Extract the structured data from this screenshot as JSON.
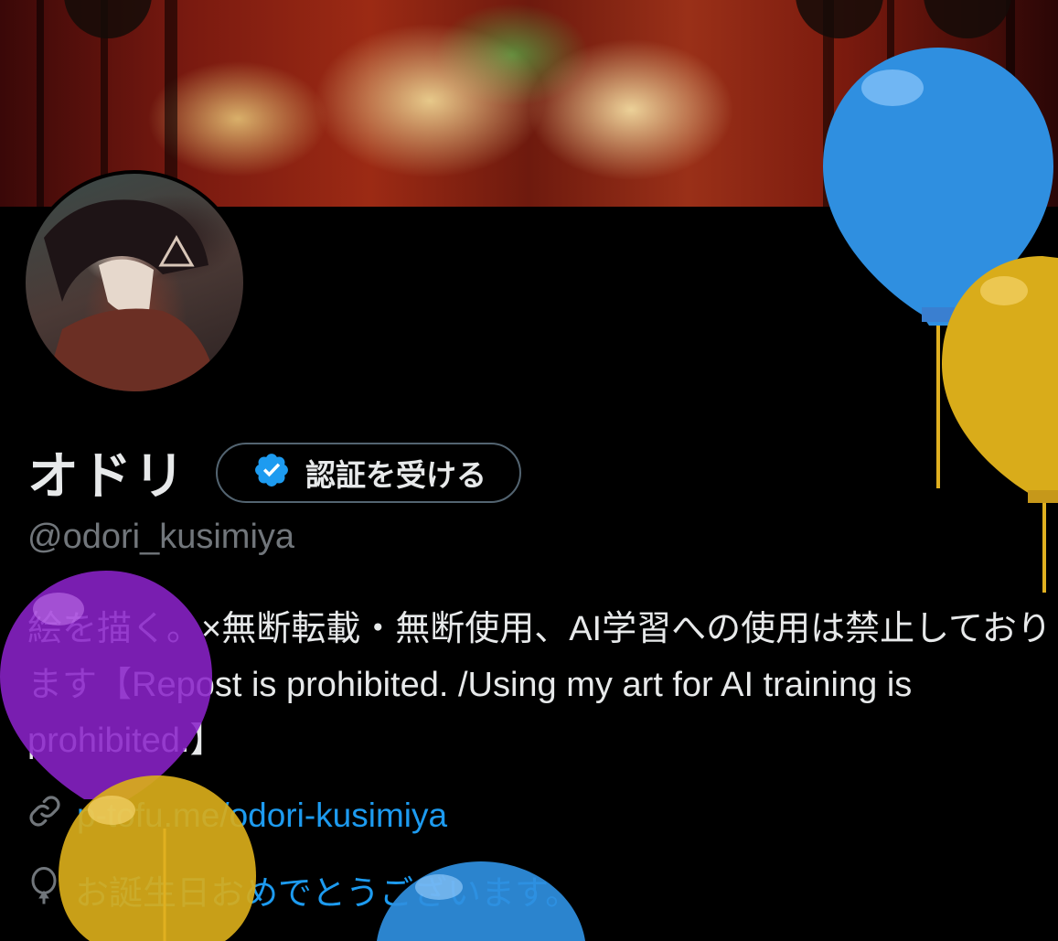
{
  "profile": {
    "display_name": "オドリ",
    "verify_label": "認証を受ける",
    "handle": "@odori_kusimiya",
    "bio": "絵を描く。×無断転載・無断使用、AI学習への使用は禁止しております【Repost is prohibited. /Using my art for AI training is prohibited.】",
    "website": "p-tofu.me/odori-kusimiya",
    "birthday_message": "お誕生日おめでとうございます。"
  },
  "icons": {
    "verify": "verified-badge-icon",
    "link": "link-icon",
    "birthday": "balloon-icon"
  },
  "colors": {
    "background": "#000000",
    "accent": "#1d9bf0",
    "secondary_text": "#71767b",
    "balloon_blue": "#2f8fe0",
    "balloon_yellow": "#d9ac1a",
    "balloon_purple": "#8a22c8"
  }
}
